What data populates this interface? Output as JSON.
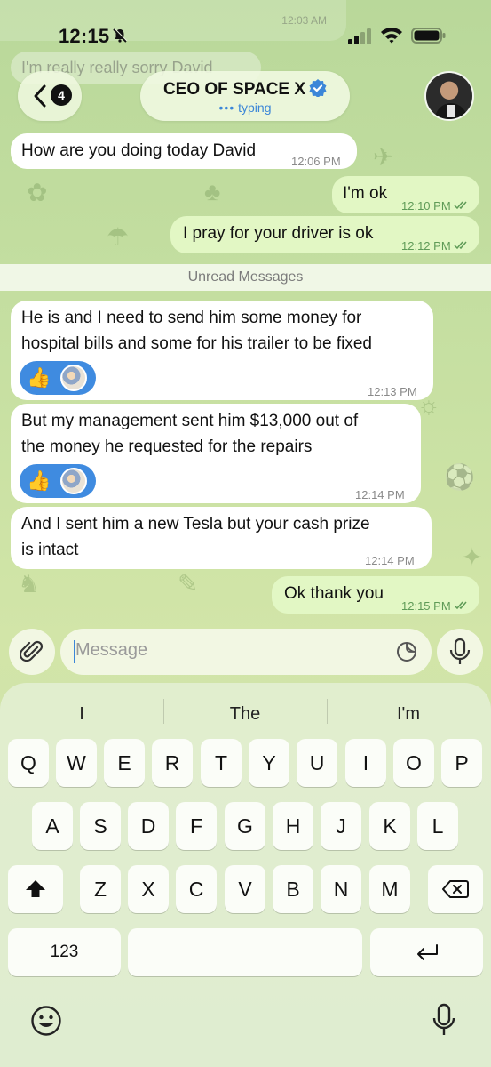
{
  "status_bar": {
    "time": "12:15"
  },
  "header": {
    "back_badge": "4",
    "title": "CEO OF SPACE X",
    "typing_dots": "•••",
    "status": "typing"
  },
  "background_messages": {
    "partial_text": "I'm really really sorry David",
    "partial_time": "12:03 AM"
  },
  "unread_label": "Unread Messages",
  "messages": [
    {
      "text": "How are you doing today David",
      "time": "12:06 PM"
    },
    {
      "text": "I'm ok",
      "time": "12:10 PM"
    },
    {
      "text": "I pray for your driver is ok",
      "time": "12:12 PM"
    },
    {
      "line1": "He is and I need to send him some money for",
      "line2": "hospital bills and some for his trailer to be fixed",
      "time": "12:13 PM"
    },
    {
      "line1": "But my management sent him $13,000 out of",
      "line2": "the money he requested for the repairs",
      "time": "12:14 PM"
    },
    {
      "line1": "And I sent him a new Tesla but your cash prize",
      "line2": "is intact",
      "time": "12:14 PM"
    },
    {
      "text": "Ok thank you",
      "time": "12:15 PM"
    }
  ],
  "reaction_emoji": "👍",
  "composer": {
    "placeholder": "Message"
  },
  "keyboard": {
    "suggestions": [
      "I",
      "The",
      "I'm"
    ],
    "row1": [
      "Q",
      "W",
      "E",
      "R",
      "T",
      "Y",
      "U",
      "I",
      "O",
      "P"
    ],
    "row2": [
      "A",
      "S",
      "D",
      "F",
      "G",
      "H",
      "J",
      "K",
      "L"
    ],
    "row3": [
      "Z",
      "X",
      "C",
      "V",
      "B",
      "N",
      "M"
    ],
    "numbers_key": "123"
  },
  "colors": {
    "accent": "#3b86d8",
    "outgoing_bubble": "#e2f7c4",
    "incoming_bubble": "#ffffff",
    "reaction_pill": "#3f8be0"
  }
}
